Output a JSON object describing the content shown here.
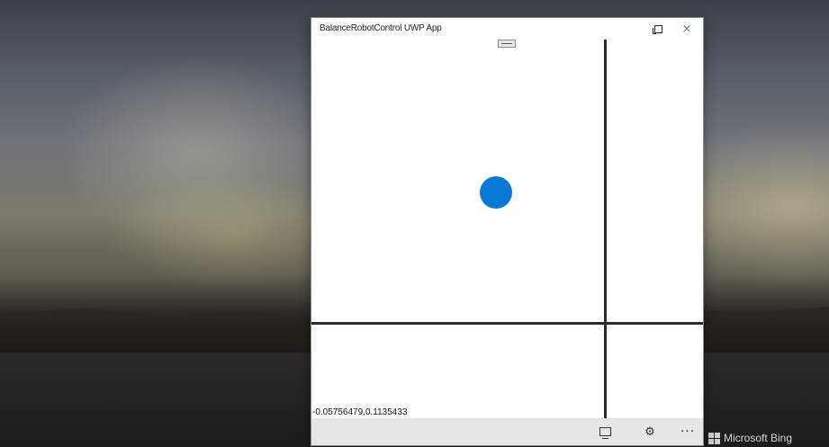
{
  "desktop": {
    "brand_label": "Microsoft Bing"
  },
  "window": {
    "title": "BalanceRobotControl UWP App",
    "restore_icon": "restore-icon",
    "close_symbol": "×"
  },
  "canvas": {
    "coordinates_readout": "-0.05756479,0.1135433",
    "ball_color": "#0a78d7"
  },
  "appbar": {
    "display_icon": "display-icon",
    "settings_symbol": "⚙",
    "more_symbol": "···"
  }
}
